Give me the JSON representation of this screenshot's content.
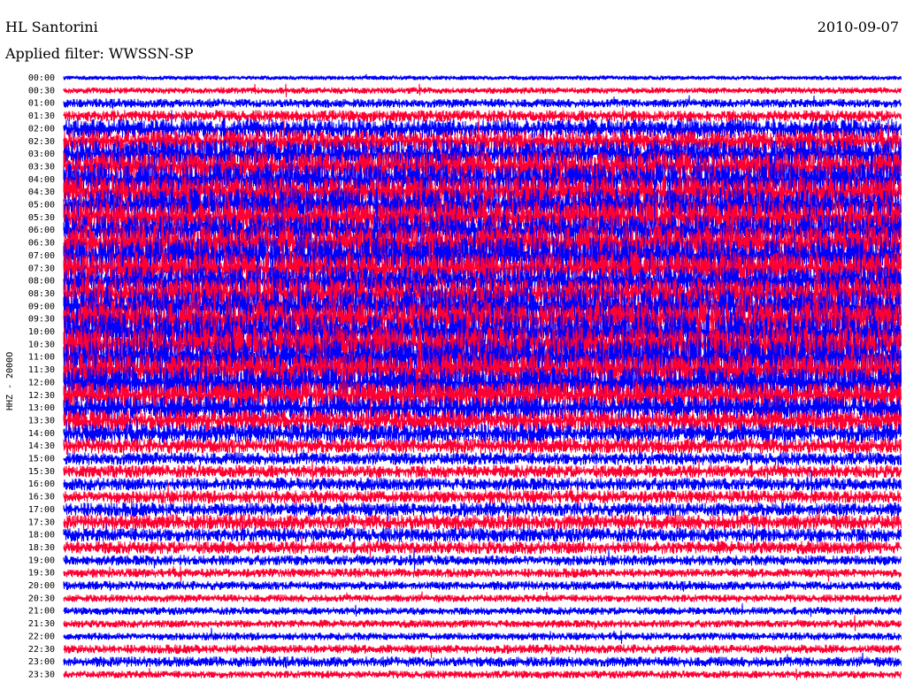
{
  "header": {
    "station": "HL Santorini",
    "date": "2010-09-07",
    "filter_label": "Applied filter: WWSSN-SP"
  },
  "chart_data": {
    "type": "line",
    "ylabel": "HHZ - 2000O",
    "colors": [
      "#0000ff",
      "#ff0033"
    ],
    "row_times": [
      "00:00",
      "00:30",
      "01:00",
      "01:30",
      "02:00",
      "02:30",
      "03:00",
      "03:30",
      "04:00",
      "04:30",
      "05:00",
      "05:30",
      "06:00",
      "06:30",
      "07:00",
      "07:30",
      "08:00",
      "08:30",
      "09:00",
      "09:30",
      "10:00",
      "10:30",
      "11:00",
      "11:30",
      "12:00",
      "12:30",
      "13:00",
      "13:30",
      "14:00",
      "14:30",
      "15:00",
      "15:30",
      "16:00",
      "16:30",
      "17:00",
      "17:30",
      "18:00",
      "18:30",
      "19:00",
      "19:30",
      "20:00",
      "20:30",
      "21:00",
      "21:30",
      "22:00",
      "22:30",
      "23:00",
      "23:30"
    ],
    "row_amplitude": [
      0.35,
      0.5,
      0.7,
      0.9,
      1.5,
      1.8,
      2.2,
      2.4,
      2.6,
      2.6,
      2.6,
      2.7,
      2.5,
      2.9,
      2.9,
      2.6,
      2.4,
      2.6,
      2.9,
      3.0,
      3.0,
      3.0,
      3.0,
      2.7,
      2.5,
      2.2,
      1.9,
      1.7,
      1.5,
      1.2,
      1.0,
      1.0,
      1.0,
      1.0,
      1.1,
      1.2,
      1.1,
      1.0,
      0.8,
      0.7,
      0.7,
      0.6,
      0.6,
      0.6,
      0.6,
      0.7,
      0.8,
      0.6
    ]
  }
}
